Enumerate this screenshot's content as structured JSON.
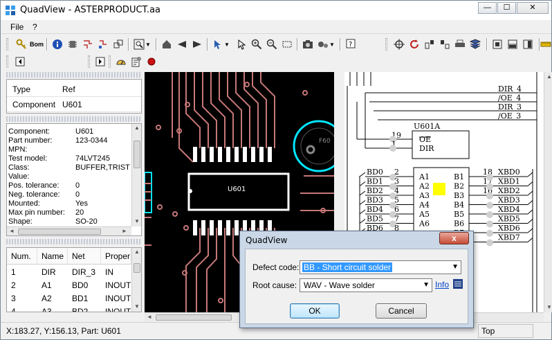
{
  "window": {
    "title": "QuadView - ASTERPRODUCT.aa",
    "minimize": "—",
    "maximize": "☐",
    "close": "✕"
  },
  "menu": {
    "items": [
      "File",
      "?"
    ]
  },
  "component_panel": {
    "rows": [
      {
        "key": "Type",
        "value": "Ref"
      },
      {
        "key": "Component",
        "value": "U601"
      }
    ]
  },
  "details_panel": {
    "lines": [
      {
        "key": "Component:",
        "value": "U601"
      },
      {
        "key": "Part number:",
        "value": "123-0344"
      },
      {
        "key": "MPN:",
        "value": ""
      },
      {
        "key": "Test model:",
        "value": "74LVT245"
      },
      {
        "key": "Class:",
        "value": "BUFFER,TRIST"
      },
      {
        "key": "Value:",
        "value": ""
      },
      {
        "key": "Pos. tolerance:",
        "value": "0"
      },
      {
        "key": "Neg. tolerance:",
        "value": "0"
      },
      {
        "key": "Mounted:",
        "value": "Yes"
      },
      {
        "key": "Max pin number:",
        "value": "20"
      },
      {
        "key": "Shape:",
        "value": "SO-20"
      }
    ]
  },
  "pins_table": {
    "headers": [
      "Num.",
      "Name",
      "Net",
      "Proper"
    ],
    "rows": [
      [
        "1",
        "DIR",
        "DIR_3",
        "IN"
      ],
      [
        "2",
        "A1",
        "BD0",
        "INOUT"
      ],
      [
        "3",
        "A2",
        "BD1",
        "INOUT"
      ],
      [
        "4",
        "A3",
        "BD2",
        "INOUT"
      ]
    ]
  },
  "pcb_view": {
    "ref_label": "U601",
    "fiducial_label": "F60"
  },
  "schematic": {
    "part_label": "U601A",
    "right_nets": [
      "DIR_4",
      "/OE_4",
      "DIR_3",
      "/OE_3"
    ],
    "control_pins": [
      {
        "num": "19",
        "name": "OE"
      },
      {
        "num": "1",
        "name": "DIR"
      }
    ],
    "left_nets": [
      "BD0",
      "BD1",
      "BD2",
      "BD3",
      "BD4",
      "BD5",
      "BD6"
    ],
    "left_pins": [
      "2",
      "3",
      "4",
      "5",
      "6",
      "7",
      "8"
    ],
    "a_pins": [
      "A1",
      "A2",
      "A3",
      "A4",
      "A5",
      "A6"
    ],
    "b_pins": [
      "B1",
      "B2",
      "B3",
      "B4",
      "B5",
      "B6",
      "B7"
    ],
    "b_pin_nums": [
      "18",
      "17",
      "16"
    ],
    "x_nets": [
      "XBD0",
      "XBD1",
      "XBD2",
      "XBD3",
      "XBD4",
      "XBD5",
      "XBD6",
      "XBD7"
    ],
    "highlight_color": "#ffff00"
  },
  "status": {
    "text": "X:183.27, Y:156.13, Part: U601",
    "side": "Top"
  },
  "dialog": {
    "title": "QuadView",
    "close": "x",
    "defect_label": "Defect code:",
    "defect_value": "BB  - Short circuit solder",
    "root_label": "Root cause:",
    "root_value": "WAV  - Wave solder",
    "info_link": "Info",
    "ok": "OK",
    "cancel": "Cancel"
  },
  "colors": {
    "trace": "#c87878",
    "pad": "#ffffff",
    "highlight": "#00e5ff",
    "selection": "#3399ff"
  }
}
